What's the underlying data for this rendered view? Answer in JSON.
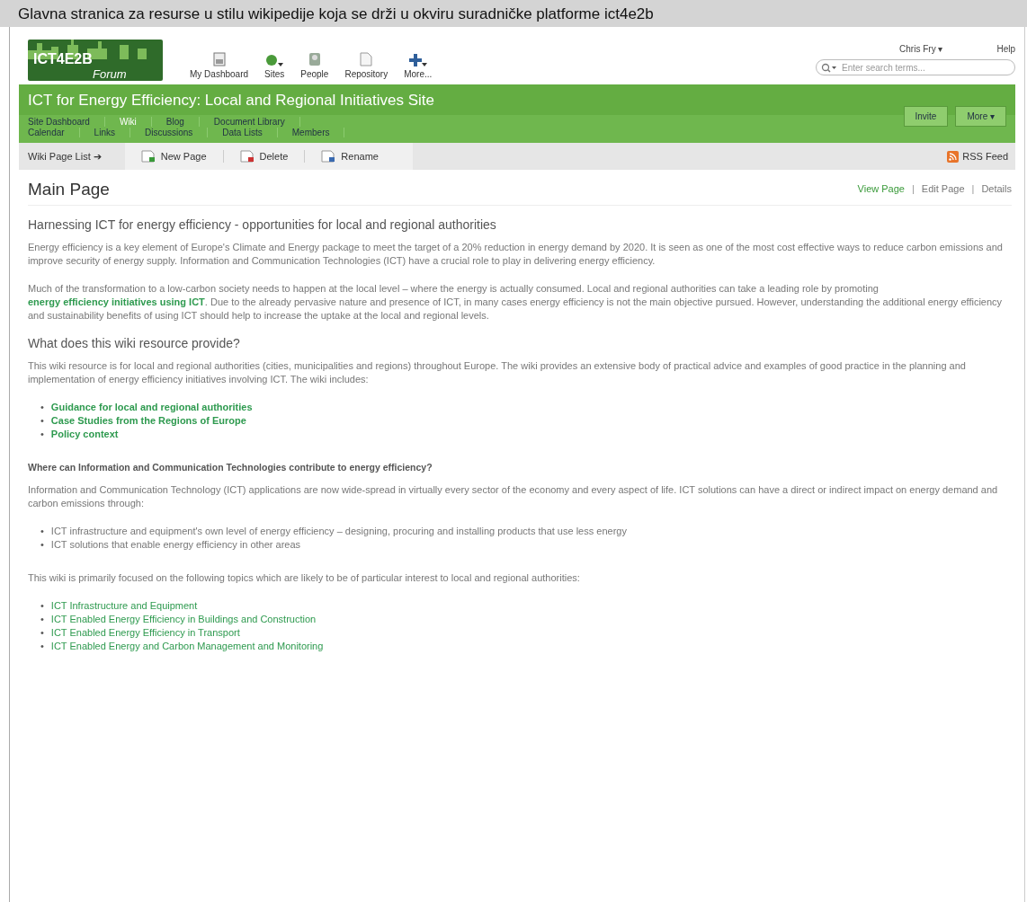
{
  "caption": "Glavna stranica za resurse u stilu wikipedije koja se drži u okviru suradničke platforme ict4e2b",
  "logo": {
    "title": "ICT4E2B",
    "subtitle": "Forum"
  },
  "app_toolbar": [
    {
      "label": "My Dashboard",
      "kind": "dashboard",
      "menu": false
    },
    {
      "label": "Sites",
      "kind": "sites",
      "menu": true
    },
    {
      "label": "People",
      "kind": "people",
      "menu": false
    },
    {
      "label": "Repository",
      "kind": "repository",
      "menu": false
    },
    {
      "label": "More...",
      "kind": "more",
      "menu": true
    }
  ],
  "user_menu": {
    "user": "Chris Fry",
    "caret": "▾",
    "help": "Help"
  },
  "search": {
    "placeholder": "Enter search terms..."
  },
  "site": {
    "title": "ICT for Energy Efficiency: Local and Regional Initiatives Site",
    "nav_rows": [
      [
        {
          "label": "Site Dashboard",
          "selected": false
        },
        {
          "label": "Wiki",
          "selected": true
        },
        {
          "label": "Blog",
          "selected": false
        },
        {
          "label": "Document Library",
          "selected": false
        }
      ],
      [
        {
          "label": "Calendar",
          "selected": false
        },
        {
          "label": "Links",
          "selected": false
        },
        {
          "label": "Discussions",
          "selected": false
        },
        {
          "label": "Data Lists",
          "selected": false
        },
        {
          "label": "Members",
          "selected": false
        }
      ]
    ],
    "buttons": [
      {
        "label": "Invite"
      },
      {
        "label": "More",
        "caret": "▾"
      }
    ]
  },
  "wiki_toolbar": {
    "page_list": {
      "label": "Wiki Page List",
      "arrow": "➔"
    },
    "actions": [
      {
        "label": "New Page",
        "kind": "new"
      },
      {
        "label": "Delete",
        "kind": "delete"
      },
      {
        "label": "Rename",
        "kind": "rename"
      }
    ],
    "rss": "RSS Feed"
  },
  "page": {
    "title": "Main Page",
    "views": [
      {
        "label": "View Page",
        "selected": true
      },
      {
        "separator": "|",
        "label": "Edit Page",
        "selected": false
      },
      {
        "separator": "|",
        "label": "Details",
        "selected": false
      }
    ],
    "blocks": [
      {
        "kind": "heading",
        "text": "Harnessing ICT for energy efficiency - opportunities for local and regional authorities"
      },
      {
        "kind": "paragraph",
        "parts": [
          {
            "text": "Energy efficiency is a key element of Europe's Climate and Energy package to meet the target of a 20% reduction in energy demand by 2020. It is seen as one of the most cost effective ways to reduce carbon emissions and improve security of energy supply. Information and Communication Technologies (ICT) have a crucial role to play in delivering energy efficiency.",
            "link": false
          }
        ]
      },
      {
        "kind": "paragraph",
        "parts": [
          {
            "text": "Much of the transformation to a low-carbon society needs to happen at the local level – where the energy is actually consumed. Local and regional authorities can take a leading role by promoting ",
            "link": false
          },
          {
            "text": "energy efficiency initiatives using ICT",
            "link": true
          },
          {
            "text": ". Due to the already pervasive nature and presence of ICT, in many cases energy efficiency is not the main objective pursued. However, understanding the additional energy efficiency and sustainability benefits of using ICT should help to increase the uptake at the local and regional levels.",
            "link": false
          }
        ]
      },
      {
        "kind": "heading",
        "text": "What does this wiki resource provide?"
      },
      {
        "kind": "paragraph",
        "parts": [
          {
            "text": "This wiki resource is for local and regional authorities (cities, municipalities and regions) throughout Europe.  The wiki provides an extensive body of practical advice and examples of good practice in the planning and implementation of energy efficiency initiatives involving ICT.  The wiki includes:",
            "link": false
          }
        ]
      },
      {
        "kind": "boldlinks",
        "items": [
          {
            "bullet": "•",
            "text": "Guidance for local and regional authorities"
          },
          {
            "bullet": "•",
            "text": "Case Studies from the Regions of Europe"
          },
          {
            "bullet": "•",
            "text": "Policy context"
          }
        ]
      },
      {
        "kind": "subheading",
        "text": "Where can Information and Communication Technologies contribute to energy efficiency?"
      },
      {
        "kind": "paragraph",
        "parts": [
          {
            "text": "Information and Communication Technology (ICT) applications are now wide-spread in virtually every sector of the economy and every aspect of life.  ICT solutions can have a direct or indirect impact on energy demand and carbon emissions through:",
            "link": false
          }
        ]
      },
      {
        "kind": "bullets",
        "items": [
          {
            "bullet": "•",
            "text": "ICT infrastructure and equipment's own level of energy efficiency – designing, procuring and installing products that use less energy"
          },
          {
            "bullet": "•",
            "text": "ICT solutions that enable energy efficiency in other areas"
          }
        ]
      },
      {
        "kind": "paragraph",
        "parts": [
          {
            "text": "This wiki is primarily focused on the following topics which are likely to be of particular interest to local and regional authorities:",
            "link": false
          }
        ]
      },
      {
        "kind": "links",
        "items": [
          {
            "bullet": "•",
            "text": "ICT Infrastructure and Equipment"
          },
          {
            "bullet": "•",
            "text": "ICT Enabled Energy Efficiency in Buildings and Construction"
          },
          {
            "bullet": "•",
            "text": "ICT Enabled Energy Efficiency in Transport"
          },
          {
            "bullet": "•",
            "text": "ICT Enabled Energy and Carbon Management and Monitoring"
          }
        ]
      }
    ]
  }
}
